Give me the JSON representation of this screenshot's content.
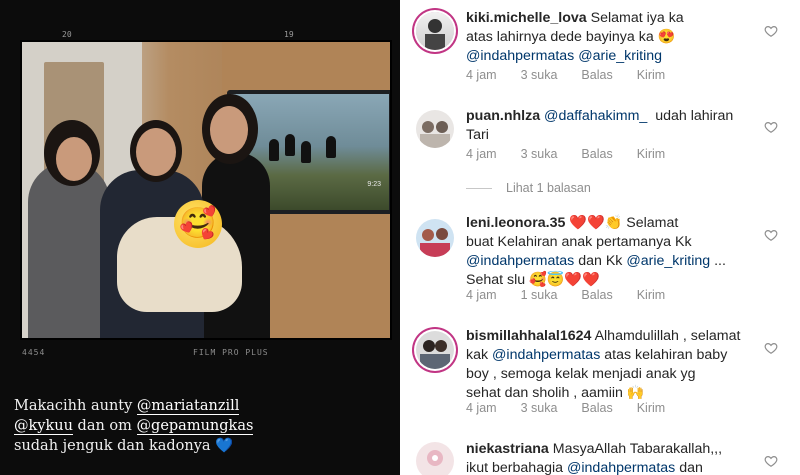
{
  "story": {
    "film_top_left": "20",
    "film_top_right": "19",
    "film_bottom_left": "4454",
    "film_bottom_center": "FILM PRO PLUS",
    "tv_label": "9:23",
    "caption_lines": [
      {
        "pre": "Makacihh aunty ",
        "mention": "@mariatanzill",
        "post": ""
      },
      {
        "pre": "",
        "mention": "@kykuu",
        "post": " dan om "
      },
      {
        "pre": "",
        "mention": "",
        "post": "sudah jenguk dan kadonya "
      }
    ],
    "caption_line2_mention2": "@gepamungkas",
    "caption_heart": "💙",
    "sticker_emoji": "🥰"
  },
  "comments": [
    {
      "username": "kiki.michelle_lova",
      "text_lines": [
        "Selamat iya ka",
        "atas lahirnya dede bayinya ka 😍"
      ],
      "mentions_line": [
        "@indahpermatas",
        "@arie_kriting"
      ],
      "time": "4 jam",
      "likes": "3 suka",
      "reply": "Balas",
      "send": "Kirim"
    },
    {
      "username": "puan.nhlza",
      "mention": "@daffahakimm_",
      "text_after": "udah lahiran",
      "text_line2": "Tari",
      "time": "4 jam",
      "likes": "3 suka",
      "reply": "Balas",
      "send": "Kirim"
    },
    {
      "username": "leni.leonora.35",
      "text_line1": "❤️❤️👏 Selamat",
      "text_line2": "buat Kelahiran anak pertamanya Kk",
      "mention1": "@indahpermatas",
      "mid": "dan Kk",
      "mention2": "@arie_kriting",
      "ellipsis": "...",
      "text_line4": "Sehat slu 🥰😇❤️❤️",
      "time": "4 jam",
      "likes": "1 suka",
      "reply": "Balas",
      "send": "Kirim"
    },
    {
      "username": "bismillahhalal1624",
      "text_line1": "Alhamdulillah , selamat",
      "text_line2_pre": "kak",
      "mention": "@indahpermatas",
      "text_line2_post": "atas kelahiran baby",
      "text_line3": "boy , semoga kelak menjadi anak yg",
      "text_line4": "sehat dan sholih , aamiin 🙌",
      "time": "4 jam",
      "likes": "3 suka",
      "reply": "Balas",
      "send": "Kirim"
    },
    {
      "username": "niekastriana",
      "text_line1": "MasyaAllah Tabarakallah,,,",
      "text_line2_pre": "ikut berbahagia",
      "mention": "@indahpermatas",
      "text_line2_post": "dan"
    }
  ],
  "view_replies": "Lihat 1 balasan",
  "colors": {
    "mention": "#00376b",
    "meta": "#8e8e8e",
    "story_ring": "#c13584"
  },
  "icons": [
    "heart-outline-icon"
  ]
}
